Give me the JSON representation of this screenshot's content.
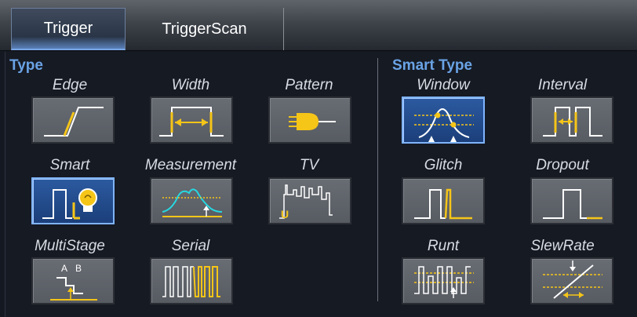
{
  "tabs": [
    {
      "label": "Trigger",
      "active": true
    },
    {
      "label": "TriggerScan",
      "active": false
    }
  ],
  "type_section": {
    "title": "Type",
    "items": [
      {
        "label": "Edge",
        "icon": "edge-icon",
        "selected": false
      },
      {
        "label": "Width",
        "icon": "width-icon",
        "selected": false
      },
      {
        "label": "Pattern",
        "icon": "pattern-icon",
        "selected": false
      },
      {
        "label": "Smart",
        "icon": "smart-icon",
        "selected": true
      },
      {
        "label": "Measurement",
        "icon": "measurement-icon",
        "selected": false
      },
      {
        "label": "TV",
        "icon": "tv-icon",
        "selected": false
      },
      {
        "label": "MultiStage",
        "icon": "multistage-icon",
        "selected": false
      },
      {
        "label": "Serial",
        "icon": "serial-icon",
        "selected": false
      }
    ]
  },
  "smart_section": {
    "title": "Smart Type",
    "items": [
      {
        "label": "Window",
        "icon": "window-icon",
        "selected": true
      },
      {
        "label": "Interval",
        "icon": "interval-icon",
        "selected": false
      },
      {
        "label": "Glitch",
        "icon": "glitch-icon",
        "selected": false
      },
      {
        "label": "Dropout",
        "icon": "dropout-icon",
        "selected": false
      },
      {
        "label": "Runt",
        "icon": "runt-icon",
        "selected": false
      },
      {
        "label": "SlewRate",
        "icon": "slewrate-icon",
        "selected": false
      }
    ]
  },
  "icon_letters": {
    "multistage_a": "A",
    "multistage_b": "B",
    "tv_u": "U"
  },
  "colors": {
    "accent": "#6aa3e6",
    "trace_yellow": "#f5c518",
    "trace_white": "#ffffff",
    "trace_cyan": "#27d7e0",
    "selected_bg": "#2c5aa0"
  }
}
